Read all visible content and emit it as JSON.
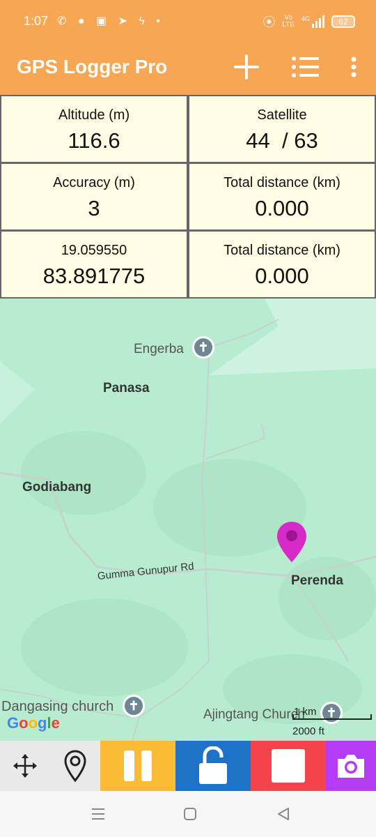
{
  "status_bar": {
    "time": "1:07",
    "network_label_top": "Vo",
    "network_label_bottom": "LTE",
    "network_type": "4G",
    "battery": "62"
  },
  "app_bar": {
    "title": "GPS Logger Pro",
    "background": "#f7a653",
    "icons": [
      "plus-icon",
      "list-icon",
      "overflow-menu-icon"
    ]
  },
  "info": [
    {
      "label": "Altitude (m)",
      "value": "116.6"
    },
    {
      "label": "Satellite",
      "value": "44  / 63"
    },
    {
      "label": "Accuracy (m)",
      "value": "3"
    },
    {
      "label": "Total distance (km)",
      "value": "0.000"
    },
    {
      "label": "19.059550",
      "value": "83.891775"
    },
    {
      "label": "Total distance (km)",
      "value": "0.000"
    }
  ],
  "map": {
    "places": {
      "engerba": "Engerba",
      "panasa": "Panasa",
      "godiabang": "Godiabang",
      "perenda": "Perenda",
      "dangasing": "Dangasing church",
      "ajingtang": "Ajingtang Church"
    },
    "road": "Gumma Gunupur Rd",
    "attribution": "Google",
    "scale_metric": "1 km",
    "scale_imperial": "2000 ft",
    "marker_color": "#d62bc9"
  },
  "toolbar": {
    "buttons": [
      {
        "icon": "move-arrows-icon",
        "color": "#e9e9e9"
      },
      {
        "icon": "location-pin-icon",
        "color": "#e9e9e9"
      },
      {
        "icon": "pause-icon",
        "color": "#fbbb34"
      },
      {
        "icon": "unlock-icon",
        "color": "#1e73c9"
      },
      {
        "icon": "stop-icon",
        "color": "#f4434a"
      },
      {
        "icon": "camera-icon",
        "color": "#b43cf5"
      }
    ]
  },
  "system_nav": [
    "recents-icon",
    "home-icon",
    "back-icon"
  ]
}
